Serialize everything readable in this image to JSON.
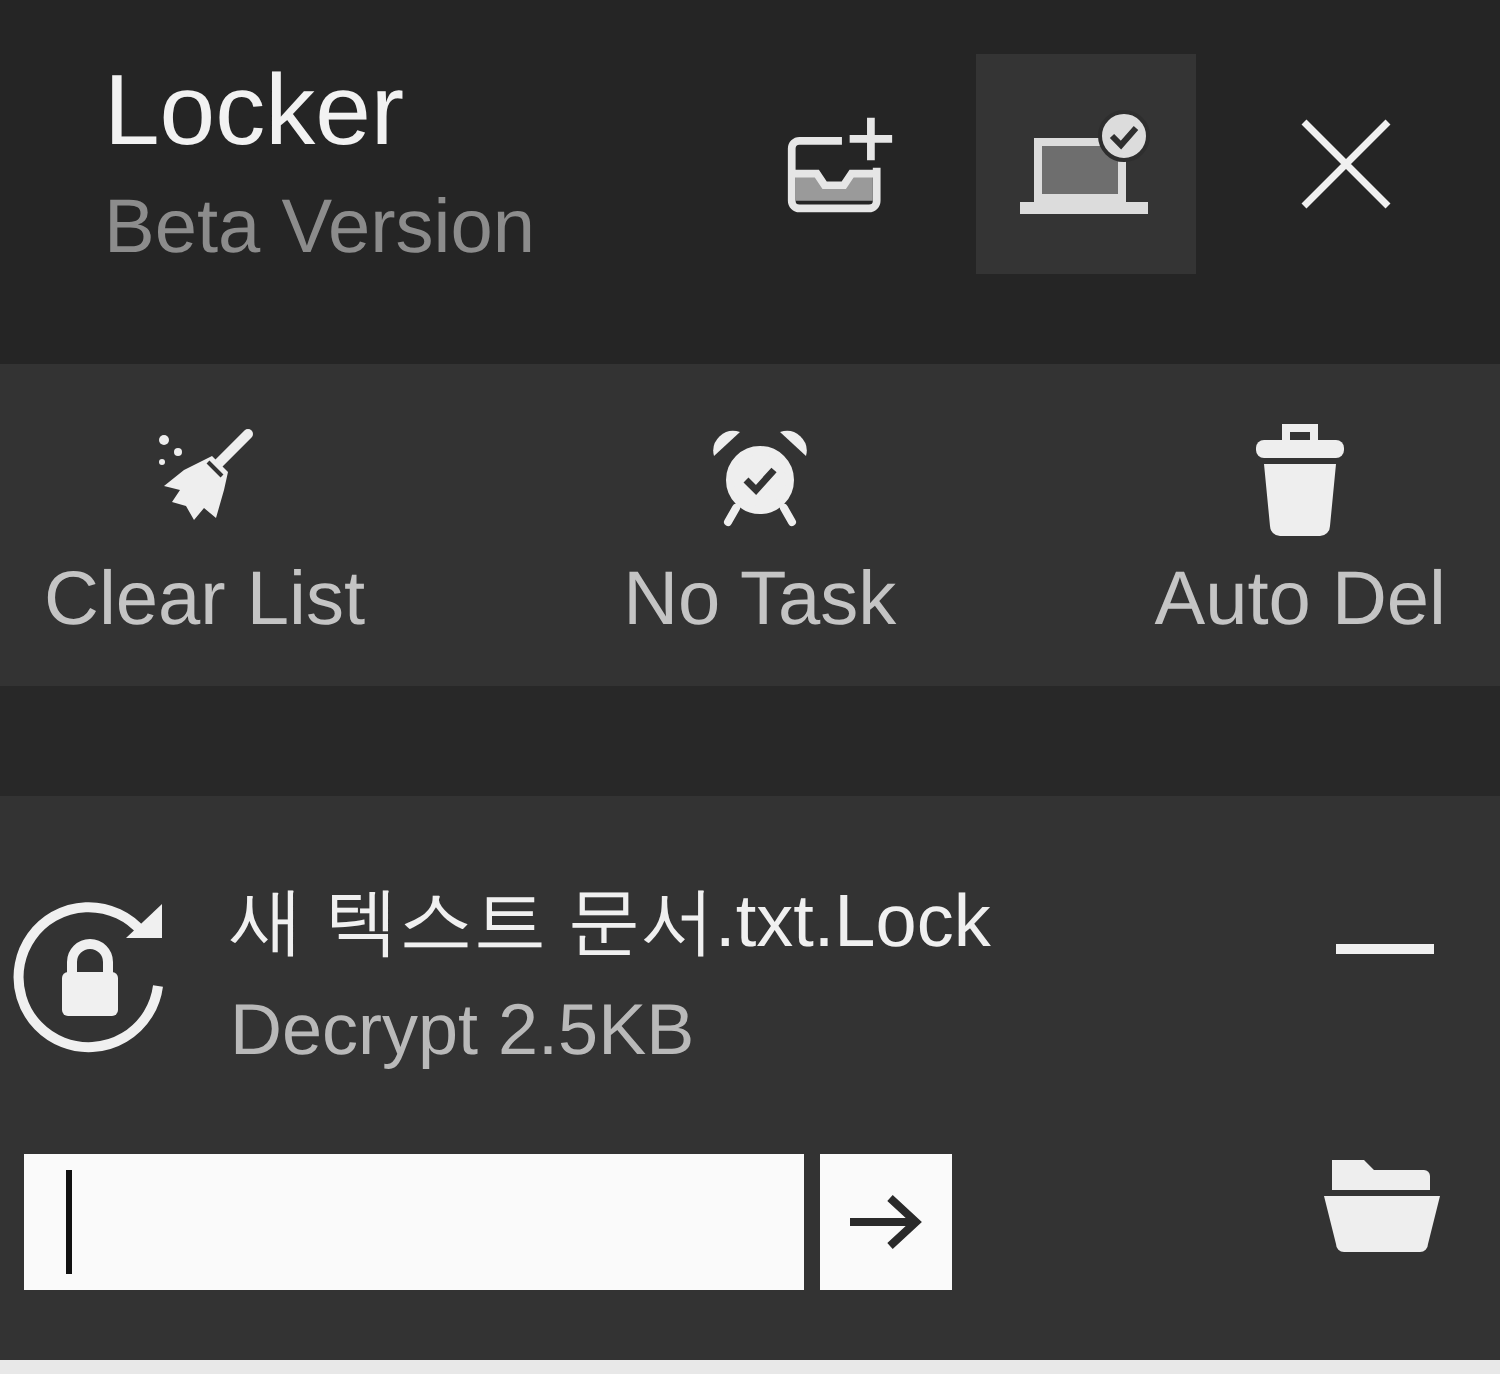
{
  "header": {
    "title": "Locker",
    "subtitle": "Beta Version",
    "buttons": [
      {
        "selected": false
      },
      {
        "selected": true
      }
    ]
  },
  "toolbar": {
    "items": [
      {
        "label": "Clear List"
      },
      {
        "label": "No Task"
      },
      {
        "label": "Auto Del"
      }
    ]
  },
  "files": [
    {
      "name": "새 텍스트 문서.txt.Lock",
      "detail": "Decrypt 2.5KB",
      "input": {
        "focused": true
      }
    }
  ]
}
